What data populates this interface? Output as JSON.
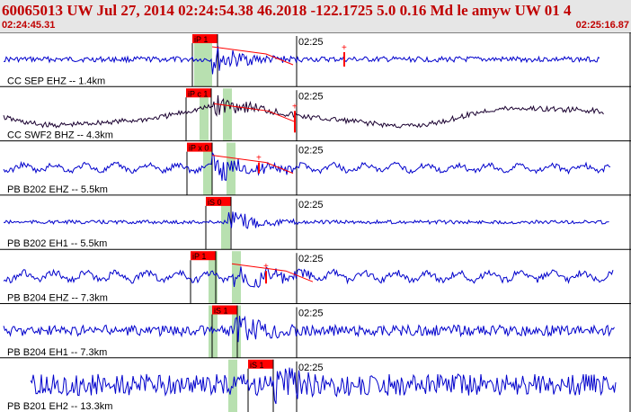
{
  "header": {
    "title": "60065013 UW Jul 27, 2014 02:24:54.38    46.2018 -122.1725  5.0 0.16 Md le amyw UW 01    4",
    "start_time": "02:24:45.31",
    "end_time": "02:25:16.87"
  },
  "colors": {
    "trace": "#0000cc",
    "trace_dark": "#1a0030",
    "pick": "#ff0000",
    "pick_window": "#b8e0b0",
    "header_text": "#c00000",
    "header_bg": "#e6e6e6"
  },
  "panels": [
    {
      "label": "CC SEP EHZ -- 1.4km",
      "time_label": "02:25",
      "pick_label": "iP 1",
      "amp": 3,
      "event_amp": 16,
      "dark": false,
      "rise": true
    },
    {
      "label": "CC SWF2 BHZ -- 4.3km",
      "time_label": "02:25",
      "pick_label": "iP c 1",
      "amp": 3,
      "event_amp": 14,
      "dark": true,
      "rise": true
    },
    {
      "label": "PB B202 EHZ -- 5.5km",
      "time_label": "02:25",
      "pick_label": "iP x 0",
      "amp": 5,
      "event_amp": 10,
      "dark": false,
      "rise": true
    },
    {
      "label": "PB B202 EH1 -- 5.5km",
      "time_label": "02:25",
      "pick_label": "iS 0",
      "amp": 2,
      "event_amp": 14,
      "dark": false,
      "rise": false
    },
    {
      "label": "PB B204 EHZ -- 7.3km",
      "time_label": "02:25",
      "pick_label": "iP 1",
      "amp": 6,
      "event_amp": 10,
      "dark": false,
      "rise": true
    },
    {
      "label": "PB B204 EH1 -- 7.3km",
      "time_label": "02:25",
      "pick_label": "iS 1",
      "amp": 6,
      "event_amp": 14,
      "dark": false,
      "rise": false
    },
    {
      "label": "PB B201 EH2 -- 13.3km",
      "time_label": "02:25",
      "pick_label": "iS 1",
      "amp": 12,
      "event_amp": 16,
      "dark": false,
      "rise": false
    }
  ]
}
